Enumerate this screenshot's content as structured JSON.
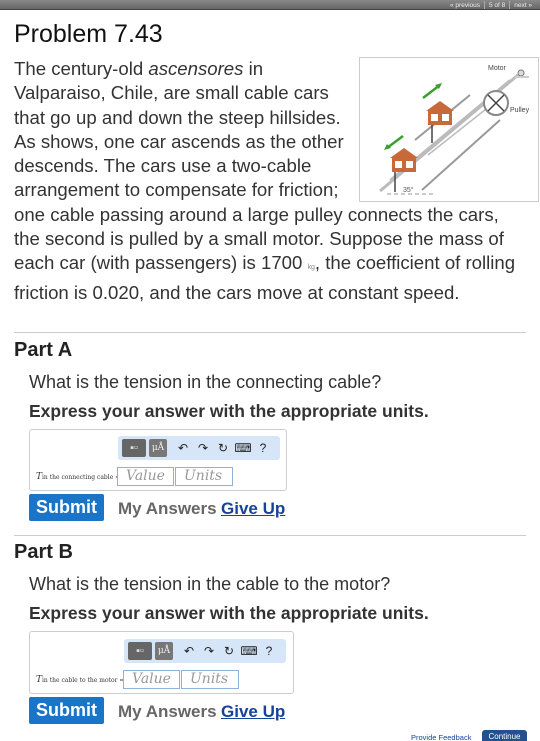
{
  "nav": {
    "previous": "« previous",
    "position": "5 of 8",
    "next": "next »"
  },
  "title": "Problem 7.43",
  "problem": {
    "p1": "The century-old ",
    "em": "ascensores",
    "p2": " in Valparaiso, Chile, are small cable cars that go up and down the steep hillsides. As shows, one car ascends as the other descends. The cars use a two-cable arrangement to compensate for friction; one cable passing around a large pulley connects the cars, the second is pulled by a small motor. Suppose the mass of each car (with passengers) is 1700 ",
    "unit": "kg",
    "p3": ", the coefficient of rolling friction is 0.020, and the cars move at constant speed."
  },
  "figure": {
    "motor_label": "Motor",
    "pulley_label": "Pulley",
    "angle_label": "35°",
    "arrow_color": "#3aa02c",
    "car_color": "#c8693a"
  },
  "toolbar": {
    "templates_icon": "templates-icon",
    "units_label": "μÅ",
    "undo": "↶",
    "redo": "↷",
    "reset": "↻",
    "keyboard": "⌨",
    "help": "?"
  },
  "parts": [
    {
      "title": "Part A",
      "question": "What is the tension in the connecting cable?",
      "instruction": "Express your answer with the appropriate units.",
      "var": "T",
      "subscript": "in the connecting cable",
      "equals": "=",
      "value_placeholder": "Value",
      "units_placeholder": "Units",
      "submit": "Submit",
      "my_answers": "My Answers",
      "give_up": "Give Up"
    },
    {
      "title": "Part B",
      "question": "What is the tension in the cable to the motor?",
      "instruction": "Express your answer with the appropriate units.",
      "var": "T",
      "subscript": "in the cable to the motor",
      "equals": "=",
      "value_placeholder": "Value",
      "units_placeholder": "Units",
      "submit": "Submit",
      "my_answers": "My Answers",
      "give_up": "Give Up"
    }
  ],
  "footer": {
    "feedback": "Provide Feedback",
    "continue": "Continue"
  }
}
